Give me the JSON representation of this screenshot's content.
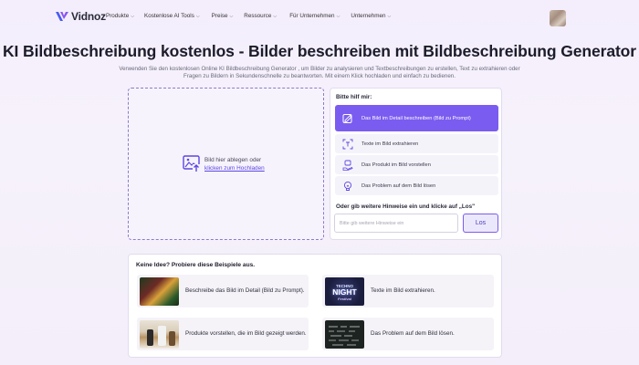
{
  "nav": {
    "logo_text": "Vidnoz",
    "menu": [
      {
        "label": "Produkte"
      },
      {
        "label": "Kostenlose AI Tools"
      },
      {
        "label": "Preise"
      },
      {
        "label": "Ressource"
      },
      {
        "label": "Für Unternehmen"
      },
      {
        "label": "Unternehmen"
      }
    ]
  },
  "hero": {
    "title": "KI Bildbeschreibung kostenlos - Bilder beschreiben mit Bildbeschreibung Generator",
    "subtitle": "Verwenden Sie den kostenlosen Online KI Bildbeschreibung Generator , um Bilder zu analysieren und Textbeschreibungen zu erstellen, Text zu extrahieren oder Fragen zu Bildern in Sekundenschnelle zu beantworten. Mit einem Klick hochladen und einfach zu bedienen."
  },
  "upload": {
    "line1": "Bild hier ablegen oder",
    "link": "klicken zum Hochladen"
  },
  "panel": {
    "title": "Bitte hilf mir:",
    "options": [
      {
        "label": "Das Bild im Detail beschreiben (Bild zu Prompt)",
        "icon": "describe-icon",
        "active": true
      },
      {
        "label": "Texte im Bild extrahieren",
        "icon": "text-scan-icon",
        "active": false
      },
      {
        "label": "Das Produkt im Bild vorstellen",
        "icon": "product-icon",
        "active": false
      },
      {
        "label": "Das Problem auf dem Bild lösen",
        "icon": "bulb-icon",
        "active": false
      }
    ],
    "hint_title": "Oder gib weitere Hinweise ein und klicke auf „Los\"",
    "hint_placeholder": "Bitte gib weitere Hinweise ein",
    "hint_value": "",
    "go_label": "Los"
  },
  "examples": {
    "title": "Keine Idee? Probiere diese Beispiele aus.",
    "items": [
      {
        "label": "Beschreibe das Bild im Detail (Bild zu Prompt).",
        "thumb": "festival-photo"
      },
      {
        "label": "Texte im Bild extrahieren.",
        "thumb": "neon-sign-photo",
        "neon_top": "TECHNO",
        "neon_mid": "NIGHT",
        "neon_bot": "Festival"
      },
      {
        "label": "Produkte vorstellen, die im Bild gezeigt werden.",
        "thumb": "products-photo"
      },
      {
        "label": "Das Problem auf dem Bild lösen.",
        "thumb": "math-chalkboard-photo"
      }
    ]
  },
  "colors": {
    "accent": "#7b5cf0",
    "link": "#5b47e0",
    "page_bg": "#f4eefc"
  }
}
